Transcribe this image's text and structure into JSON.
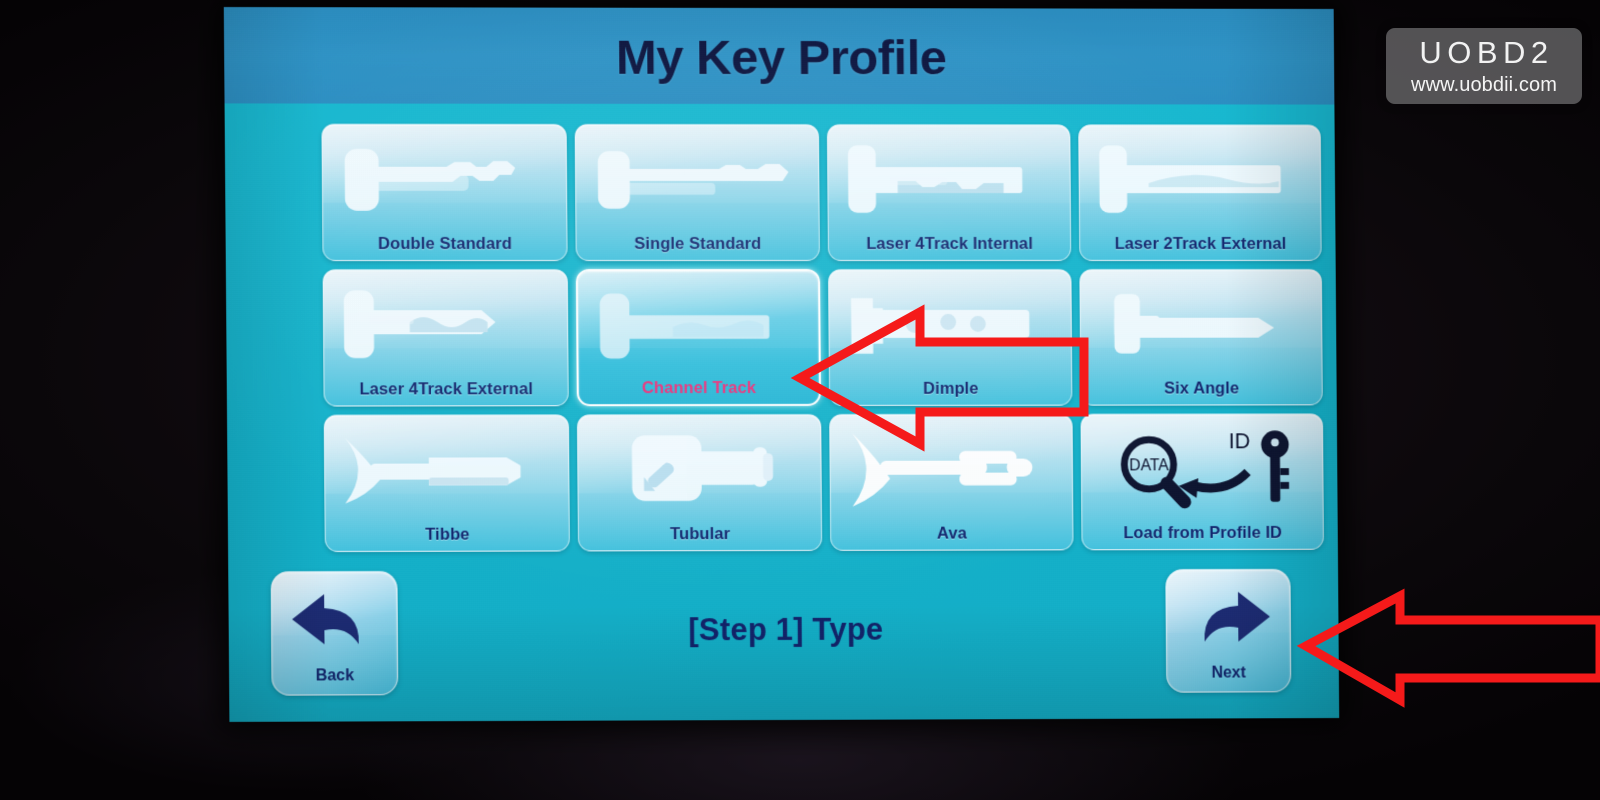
{
  "watermark": {
    "brand": "UOBD2",
    "url": "www.uobdii.com"
  },
  "header": {
    "title": "My Key Profile"
  },
  "grid": {
    "tiles": [
      {
        "label": "Double Standard",
        "icon": "double-standard-key-icon",
        "selected": false
      },
      {
        "label": "Single Standard",
        "icon": "single-standard-key-icon",
        "selected": false
      },
      {
        "label": "Laser 4Track Internal",
        "icon": "laser-4track-internal-key-icon",
        "selected": false
      },
      {
        "label": "Laser 2Track External",
        "icon": "laser-2track-external-key-icon",
        "selected": false
      },
      {
        "label": "Laser 4Track External",
        "icon": "laser-4track-external-key-icon",
        "selected": false
      },
      {
        "label": "Channel Track",
        "icon": "channel-track-key-icon",
        "selected": true
      },
      {
        "label": "Dimple",
        "icon": "dimple-key-icon",
        "selected": false
      },
      {
        "label": "Six Angle",
        "icon": "six-angle-key-icon",
        "selected": false
      },
      {
        "label": "Tibbe",
        "icon": "tibbe-key-icon",
        "selected": false
      },
      {
        "label": "Tubular",
        "icon": "tubular-key-icon",
        "selected": false
      },
      {
        "label": "Ava",
        "icon": "ava-key-icon",
        "selected": false
      },
      {
        "label": "Load from Profile ID",
        "icon": "data-search-id-key-icon",
        "selected": false
      }
    ]
  },
  "profile_id_icon": {
    "magnifier_text": "DATA",
    "id_text": "ID"
  },
  "footer": {
    "back_label": "Back",
    "next_label": "Next",
    "step_label": "[Step 1] Type"
  },
  "annotations": [
    {
      "name": "arrow-pointing-to-channel-track",
      "shape": "left-arrow-outline",
      "color": "#f51a1a"
    },
    {
      "name": "arrow-pointing-to-next-button",
      "shape": "left-arrow-outline",
      "color": "#f51a1a"
    }
  ],
  "colors": {
    "screen_bg": "#15b7cf",
    "header_bg": "#2c93c8",
    "title_text": "#0b1440",
    "tile_label": "#11266e",
    "selected_label": "#ec2f7a",
    "annotation_red": "#f51a1a",
    "surround": "#0a070a"
  }
}
